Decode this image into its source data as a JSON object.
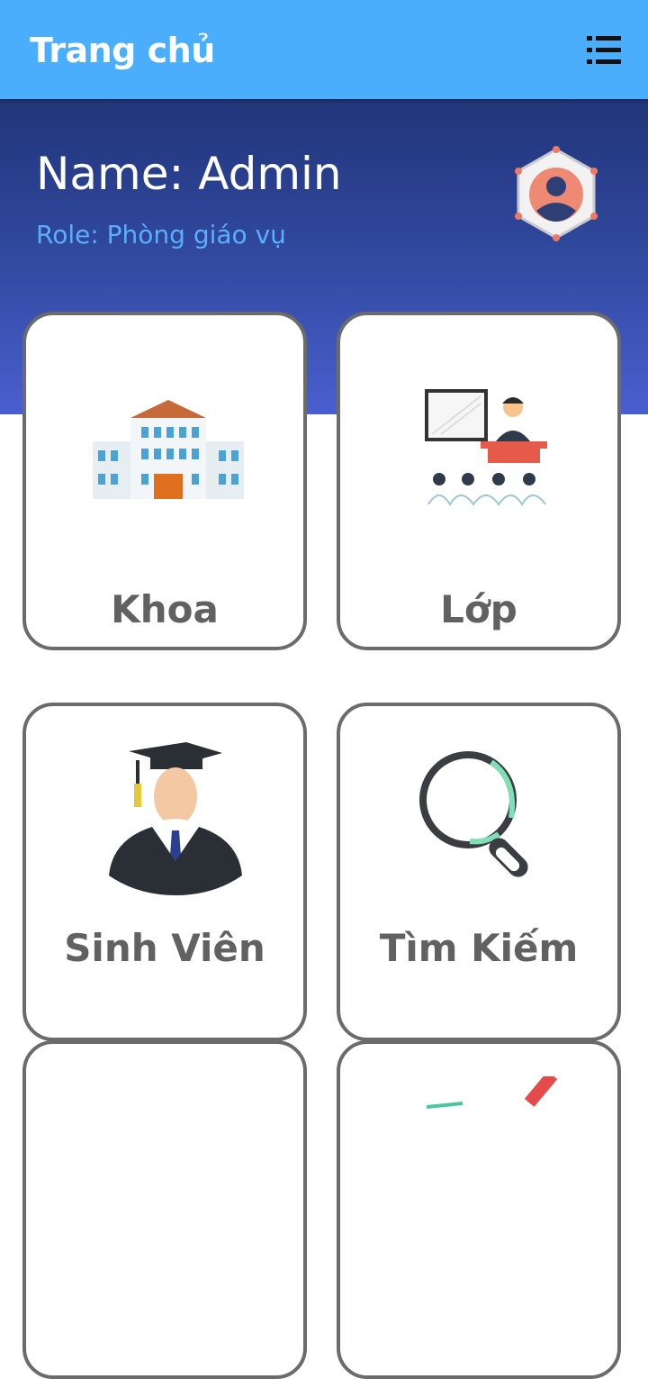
{
  "appbar": {
    "title": "Trang chủ",
    "menu_icon": "list-menu-icon"
  },
  "profile": {
    "name": "Name: Admin",
    "role": "Role: Phòng giáo vụ",
    "avatar_icon": "user-hexagon-icon"
  },
  "menu": [
    {
      "label": "Khoa",
      "icon": "school-building-icon"
    },
    {
      "label": "Lớp",
      "icon": "classroom-teacher-icon"
    },
    {
      "label": "Sinh Viên",
      "icon": "graduate-student-icon"
    },
    {
      "label": "Tìm Kiếm",
      "icon": "magnifier-icon"
    },
    {
      "label": "",
      "icon": "card-icon"
    },
    {
      "label": "",
      "icon": "chart-pencil-icon"
    }
  ],
  "colors": {
    "appbar": "#4aaefc",
    "hero_top": "#22357a",
    "hero_bottom": "#4a5fcf",
    "role_text": "#5aaefb",
    "card_border": "#6b6b6b",
    "card_text": "#616161"
  }
}
